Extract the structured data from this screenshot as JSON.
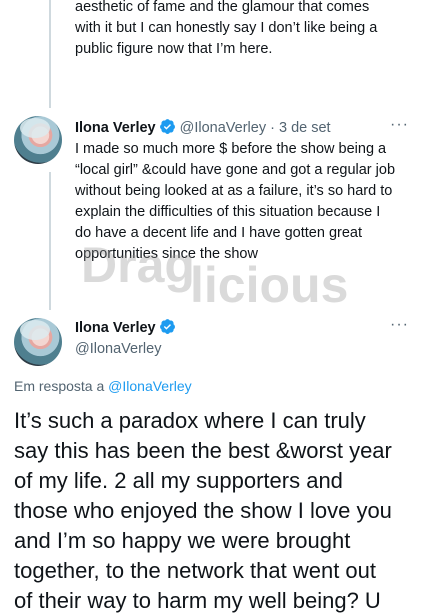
{
  "prev_tweet": {
    "text_lines": [
      "aesthetic of fame and the glamour that comes",
      "with it but I can honestly say I don’t like being a",
      "public figure now that I’m here."
    ]
  },
  "tweet_1": {
    "name": "Ilona Verley",
    "handle": "@IlonaVerley",
    "separator": "·",
    "date": "3 de set",
    "more": "···",
    "text_lines": [
      "I made so much more $ before the show being a",
      "“local girl” &could have gone and got a regular job",
      "without being looked at as a failure, it’s so hard to",
      "explain the difficulties of this situation because I",
      "do have a decent life and I have gotten great",
      "opportunities since the show"
    ]
  },
  "watermark": {
    "text_part_1": "Drag",
    "text_part_2": "licious"
  },
  "main_tweet": {
    "name": "Ilona Verley",
    "handle": "@IlonaVerley",
    "more": "···",
    "reply_prefix": "Em resposta a",
    "reply_handle": "@IlonaVerley",
    "text_lines": [
      "It’s such a paradox where I can truly",
      "say this has been the best &worst year",
      "of my life. 2 all my supporters and",
      "those who enjoyed the show I love you",
      "and I’m so happy we were brought",
      "together, to the network that went out",
      "of their way to harm my well being? U"
    ]
  },
  "colors": {
    "verified_blue": "#1d9bf0",
    "secondary_text": "#536471",
    "thread_line": "#cfd9de"
  }
}
